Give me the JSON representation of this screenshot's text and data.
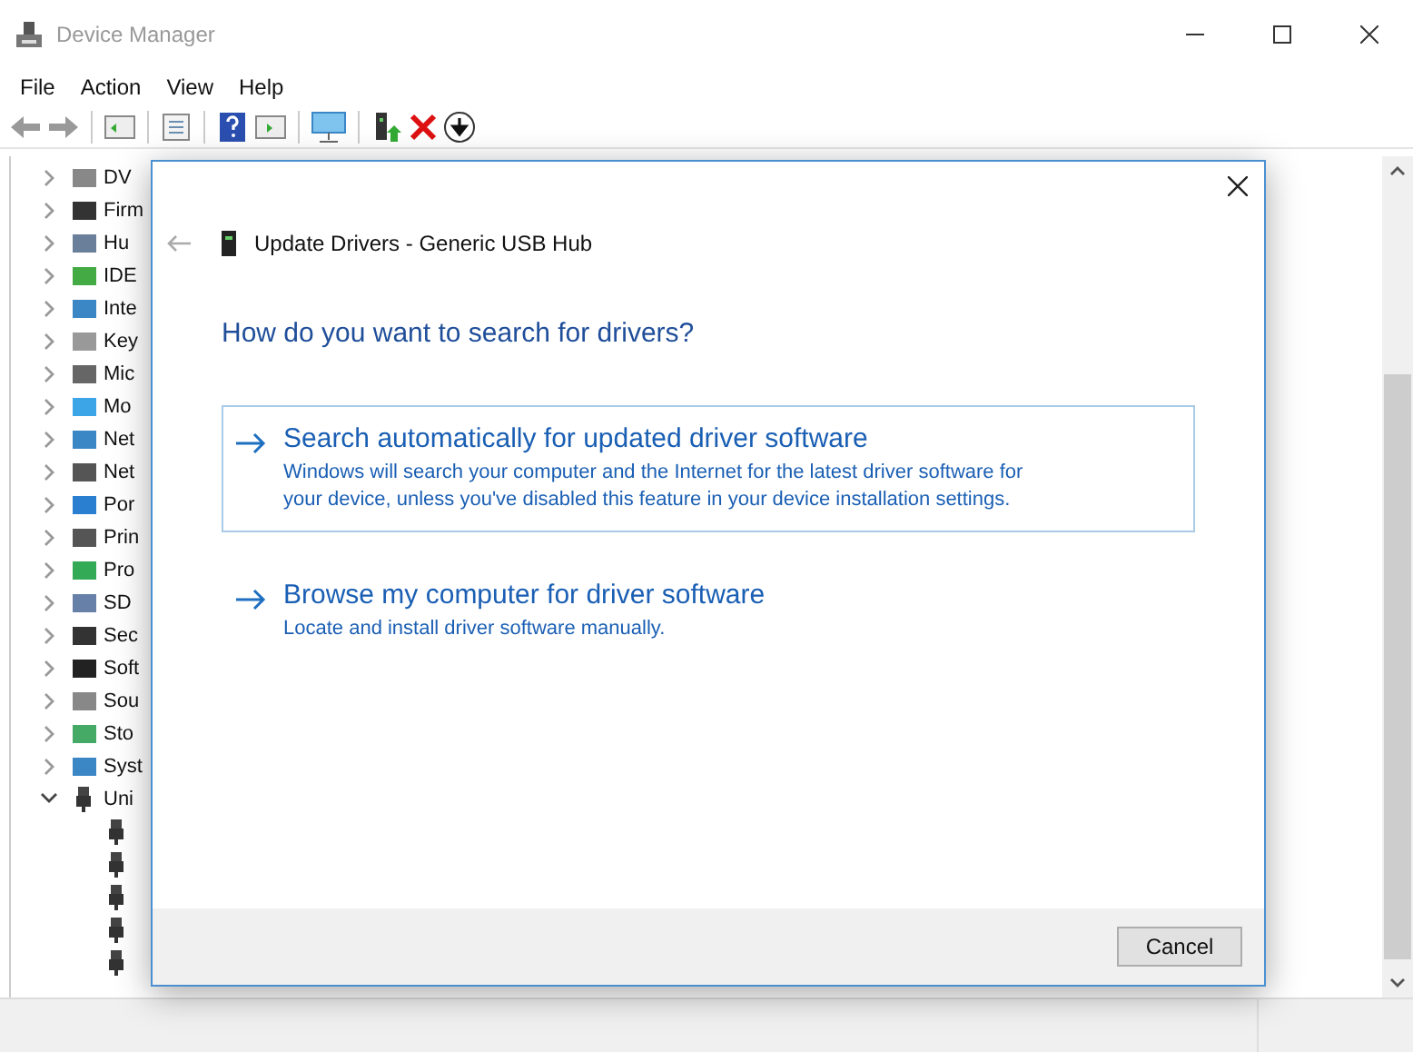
{
  "window": {
    "title": "Device Manager"
  },
  "menu": [
    "File",
    "Action",
    "View",
    "Help"
  ],
  "tree": [
    {
      "label": "DV",
      "expanded": false
    },
    {
      "label": "Firm",
      "expanded": false
    },
    {
      "label": "Hu",
      "expanded": false
    },
    {
      "label": "IDE",
      "expanded": false
    },
    {
      "label": "Inte",
      "expanded": false
    },
    {
      "label": "Key",
      "expanded": false
    },
    {
      "label": "Mic",
      "expanded": false
    },
    {
      "label": "Mo",
      "expanded": false
    },
    {
      "label": "Net",
      "expanded": false
    },
    {
      "label": "Net",
      "expanded": false
    },
    {
      "label": "Por",
      "expanded": false
    },
    {
      "label": "Prin",
      "expanded": false
    },
    {
      "label": "Pro",
      "expanded": false
    },
    {
      "label": "SD",
      "expanded": false
    },
    {
      "label": "Sec",
      "expanded": false
    },
    {
      "label": "Soft",
      "expanded": false
    },
    {
      "label": "Sou",
      "expanded": false
    },
    {
      "label": "Sto",
      "expanded": false
    },
    {
      "label": "Syst",
      "expanded": false
    },
    {
      "label": "Uni",
      "expanded": true,
      "children": [
        {
          "kind": "device"
        },
        {
          "kind": "device"
        },
        {
          "kind": "device"
        },
        {
          "kind": "device"
        },
        {
          "kind": "device"
        }
      ]
    }
  ],
  "dialog": {
    "title": "Update Drivers - Generic USB Hub",
    "heading": "How do you want to search for drivers?",
    "options": [
      {
        "title": "Search automatically for updated driver software",
        "description": "Windows will search your computer and the Internet for the latest driver software for your device, unless you've disabled this feature in your device installation settings.",
        "selected": true
      },
      {
        "title": "Browse my computer for driver software",
        "description": "Locate and install driver software manually.",
        "selected": false
      }
    ],
    "button": "Cancel"
  }
}
